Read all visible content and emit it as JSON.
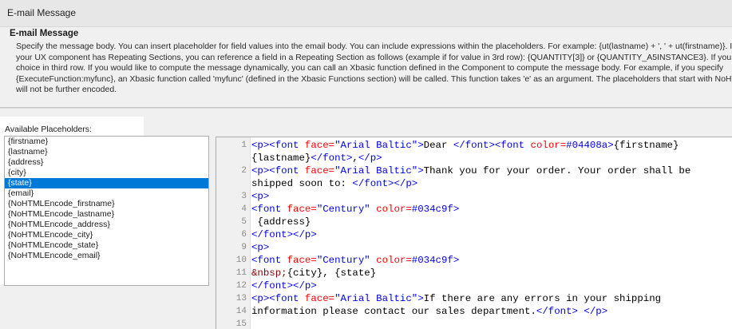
{
  "window": {
    "title": "E-mail Message"
  },
  "description": {
    "heading": "E-mail Message",
    "lines": [
      "Specify the message body. You can insert placeholder for field values into the email body. You can include expressions within the placeholders. For example: {ut(lastname) + ', ' + ut(firstname)}. If",
      "your UX component has Repeating Sections, you can reference a field in a Repeating Section as follows (example if for value in 3rd row): {QUANTITY[3]} or {QUANTITY_A5INSTANCE3}. If you",
      "choice in third row. If you would like to compute the message dynamically, you can call an Xbasic function defined in the Component to compute the message body. For example, if you specify",
      "{ExecuteFunction:myfunc}, an Xbasic function called 'myfunc' (defined in the Xbasic Functions section) will be called. This function takes 'e' as an argument. The placeholders that start with NoHTML",
      "will not be further encoded."
    ]
  },
  "placeholders": {
    "label": "Available Placeholders:",
    "items": [
      "{firstname}",
      "{lastname}",
      "{address}",
      "{city}",
      "{state}",
      "{email}",
      "{NoHTMLEncode_firstname}",
      "{NoHTMLEncode_lastname}",
      "{NoHTMLEncode_address}",
      "{NoHTMLEncode_city}",
      "{NoHTMLEncode_state}",
      "{NoHTMLEncode_email}"
    ],
    "selected_index": 4
  },
  "editor": {
    "lines": [
      {
        "num": "1",
        "segments": [
          [
            "tag",
            "<p><font "
          ],
          [
            "attr",
            "face="
          ],
          [
            "str",
            "\"Arial Baltic\""
          ],
          [
            "tag",
            ">"
          ],
          [
            "text",
            "Dear "
          ],
          [
            "tag",
            "</font><font "
          ],
          [
            "attr",
            "color="
          ],
          [
            "str",
            "#04408a"
          ],
          [
            "tag",
            ">"
          ],
          [
            "text",
            "{firstname}"
          ]
        ]
      },
      {
        "num": "",
        "segments": [
          [
            "text",
            "{lastname}"
          ],
          [
            "tag",
            "</font>"
          ],
          [
            "text",
            ","
          ],
          [
            "tag",
            "</p>"
          ]
        ]
      },
      {
        "num": "2",
        "segments": [
          [
            "tag",
            "<p><font "
          ],
          [
            "attr",
            "face="
          ],
          [
            "str",
            "\"Arial Baltic\""
          ],
          [
            "tag",
            ">"
          ],
          [
            "text",
            "Thank you for your order. Your order shall be"
          ]
        ]
      },
      {
        "num": "",
        "segments": [
          [
            "text",
            "shipped soon to: "
          ],
          [
            "tag",
            "</font></p>"
          ]
        ]
      },
      {
        "num": "3",
        "segments": [
          [
            "tag",
            "<p>"
          ]
        ]
      },
      {
        "num": "4",
        "segments": [
          [
            "tag",
            "<font "
          ],
          [
            "attr",
            "face="
          ],
          [
            "str",
            "\"Century\""
          ],
          [
            "text",
            " "
          ],
          [
            "attr",
            "color="
          ],
          [
            "str",
            "#034c9f"
          ],
          [
            "tag",
            ">"
          ]
        ]
      },
      {
        "num": "5",
        "segments": [
          [
            "text",
            " {address}"
          ]
        ]
      },
      {
        "num": "6",
        "segments": [
          [
            "tag",
            "</font></p>"
          ]
        ]
      },
      {
        "num": "9",
        "segments": [
          [
            "tag",
            "<p>"
          ]
        ]
      },
      {
        "num": "10",
        "segments": [
          [
            "tag",
            "<font "
          ],
          [
            "attr",
            "face="
          ],
          [
            "str",
            "\"Century\""
          ],
          [
            "text",
            " "
          ],
          [
            "attr",
            "color="
          ],
          [
            "str",
            "#034c9f"
          ],
          [
            "tag",
            ">"
          ]
        ]
      },
      {
        "num": "11",
        "segments": [
          [
            "ent",
            "&nbsp;"
          ],
          [
            "text",
            "{city}, {state}"
          ]
        ]
      },
      {
        "num": "12",
        "segments": [
          [
            "tag",
            "</font></p>"
          ]
        ]
      },
      {
        "num": "13",
        "segments": [
          [
            "tag",
            "<p><font "
          ],
          [
            "attr",
            "face="
          ],
          [
            "str",
            "\"Arial Baltic\""
          ],
          [
            "tag",
            ">"
          ],
          [
            "text",
            "If there are any errors in your shipping"
          ]
        ]
      },
      {
        "num": "14",
        "segments": [
          [
            "text",
            "information please contact our sales department."
          ],
          [
            "tag",
            "</font> </p>"
          ]
        ]
      },
      {
        "num": "15",
        "segments": []
      }
    ]
  }
}
